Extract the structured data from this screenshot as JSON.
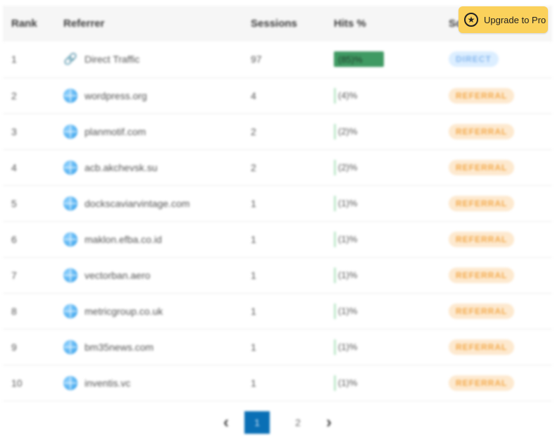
{
  "table": {
    "headers": [
      "Rank",
      "Referrer",
      "Sessions",
      "Hits %",
      "Source"
    ],
    "rows": [
      {
        "rank": "1",
        "referrer": "Direct Traffic",
        "sessions": "97",
        "hits": "(85)%",
        "hits_fraction": 0.85,
        "source": "DIRECT",
        "icon": "link-icon"
      },
      {
        "rank": "2",
        "referrer": "wordpress.org",
        "sessions": "4",
        "hits": "(4)%",
        "hits_fraction": 0.04,
        "source": "REFERRAL",
        "icon": "globe-icon"
      },
      {
        "rank": "3",
        "referrer": "planmotif.com",
        "sessions": "2",
        "hits": "(2)%",
        "hits_fraction": 0.02,
        "source": "REFERRAL",
        "icon": "globe-icon"
      },
      {
        "rank": "4",
        "referrer": "acb.akchevsk.su",
        "sessions": "2",
        "hits": "(2)%",
        "hits_fraction": 0.02,
        "source": "REFERRAL",
        "icon": "globe-icon"
      },
      {
        "rank": "5",
        "referrer": "dockscaviarvintage.com",
        "sessions": "1",
        "hits": "(1)%",
        "hits_fraction": 0.01,
        "source": "REFERRAL",
        "icon": "globe-icon"
      },
      {
        "rank": "6",
        "referrer": "maklon.efba.co.id",
        "sessions": "1",
        "hits": "(1)%",
        "hits_fraction": 0.01,
        "source": "REFERRAL",
        "icon": "globe-icon"
      },
      {
        "rank": "7",
        "referrer": "vectorban.aero",
        "sessions": "1",
        "hits": "(1)%",
        "hits_fraction": 0.01,
        "source": "REFERRAL",
        "icon": "globe-icon"
      },
      {
        "rank": "8",
        "referrer": "metricgroup.co.uk",
        "sessions": "1",
        "hits": "(1)%",
        "hits_fraction": 0.01,
        "source": "REFERRAL",
        "icon": "globe-icon"
      },
      {
        "rank": "9",
        "referrer": "bm35news.com",
        "sessions": "1",
        "hits": "(1)%",
        "hits_fraction": 0.01,
        "source": "REFERRAL",
        "icon": "globe-icon"
      },
      {
        "rank": "10",
        "referrer": "inventis.vc",
        "sessions": "1",
        "hits": "(1)%",
        "hits_fraction": 0.01,
        "source": "REFERRAL",
        "icon": "globe-icon"
      }
    ]
  },
  "pagination": {
    "pages": [
      "1",
      "2"
    ],
    "current": "1",
    "prev_icon": "chevron-left-icon",
    "next_icon": "chevron-right-icon"
  },
  "upgrade": {
    "label": "Upgrade to Pro",
    "icon": "star-icon",
    "color": "#fbd15b"
  },
  "colors": {
    "hits_bar": "#3f9a63",
    "referral_badge_bg": "#fde9cf",
    "referral_badge_text": "#f3a94a",
    "direct_badge_bg": "#dceeff",
    "direct_badge_text": "#86b7ee",
    "active_page": "#0a6fb5"
  }
}
